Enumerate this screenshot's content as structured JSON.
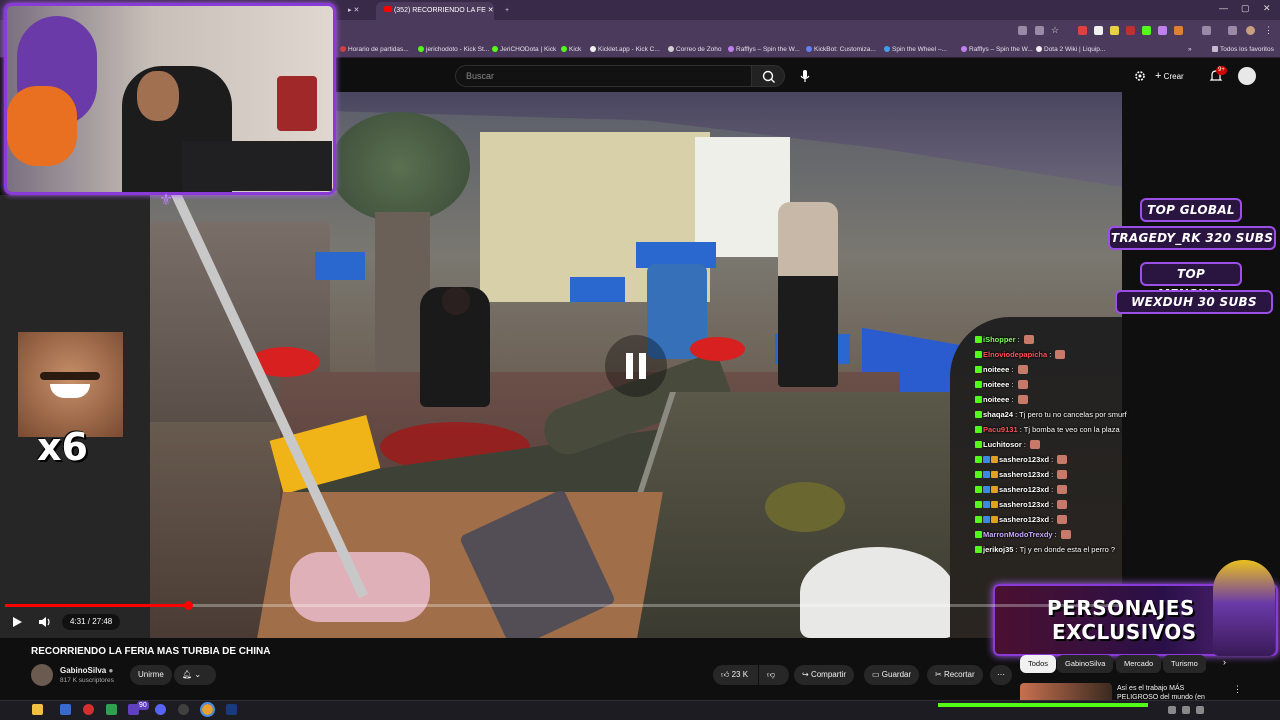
{
  "browser": {
    "tabs": [
      {
        "label": "(352) RECORRIENDO LA FE"
      }
    ],
    "bookmarks": [
      {
        "label": "Horario de partidas..."
      },
      {
        "label": "jerichodoto - Kick St..."
      },
      {
        "label": "JeriCHODota | Kick"
      },
      {
        "label": "Kick"
      },
      {
        "label": "Kicklet.app - Kick C..."
      },
      {
        "label": "Correo de Zoho"
      },
      {
        "label": "Rafflys – Spin the W..."
      },
      {
        "label": "KickBot: Customiza..."
      },
      {
        "label": "Spin the Wheel –..."
      },
      {
        "label": "Rafflys – Spin the W..."
      },
      {
        "label": "Dota 2 Wiki | Liquip..."
      }
    ],
    "all_bookmarks_label": "Todos los favoritos"
  },
  "header": {
    "search_placeholder": "Buscar",
    "create_label": "Crear",
    "notification_count": "9+"
  },
  "overlay": {
    "leaderboard": [
      {
        "label": "TOP GLOBAL"
      },
      {
        "label": "TRAGEDY_RK 320 SUBS"
      },
      {
        "label": "TOP MENSUAL"
      },
      {
        "label": "WEXDUH 30 SUBS"
      }
    ],
    "multiplier": "x6",
    "promo_line1": "PERSONAJES",
    "promo_line2": "EXCLUSIVOS"
  },
  "chat": [
    {
      "user": "iShopper",
      "message": "",
      "user_color": "#7cff5a"
    },
    {
      "user": "Elnoviodepapicha",
      "message": "",
      "user_color": "#ff4f5a"
    },
    {
      "user": "noiteee",
      "message": "",
      "user_color": "#ffffff"
    },
    {
      "user": "noiteee",
      "message": "",
      "user_color": "#ffffff"
    },
    {
      "user": "noiteee",
      "message": "",
      "user_color": "#ffffff"
    },
    {
      "user": "shaqa24",
      "message": "Tj pero tu no cancelas por smurf",
      "user_color": "#ffffff"
    },
    {
      "user": "Pacu9131",
      "message": "Tj bomba te veo con la plaza",
      "user_color": "#ff4f5a"
    },
    {
      "user": "Luchitosor",
      "message": "",
      "user_color": "#ffffff"
    },
    {
      "user": "sashero123xd",
      "message": "",
      "user_color": "#ffffff"
    },
    {
      "user": "sashero123xd",
      "message": "",
      "user_color": "#ffffff"
    },
    {
      "user": "sashero123xd",
      "message": "",
      "user_color": "#ffffff"
    },
    {
      "user": "sashero123xd",
      "message": "",
      "user_color": "#ffffff"
    },
    {
      "user": "sashero123xd",
      "message": "",
      "user_color": "#ffffff"
    },
    {
      "user": "MarronModoTrexdy",
      "message": "",
      "user_color": "#c8a8ff"
    },
    {
      "user": "jerikoj35",
      "message": "Tj y en donde esta el perro ?",
      "user_color": "#ffffff"
    }
  ],
  "player": {
    "progress": 0.164,
    "time_display": "4:31 / 27:48"
  },
  "video": {
    "title": "RECORRIENDO LA FERIA MAS TURBIA DE CHINA",
    "channel": "GabinoSilva",
    "subscribers": "817 K suscriptores",
    "join_label": "Unirme",
    "like_count": "23 K",
    "share_label": "Compartir",
    "save_label": "Guardar",
    "clip_label": "Recortar"
  },
  "sidebar": {
    "chips": [
      {
        "label": "Todos"
      },
      {
        "label": "GabinoSilva"
      },
      {
        "label": "Mercado"
      },
      {
        "label": "Turismo"
      }
    ],
    "recommendation_title": "Así es el trabajo MÁS PELIGROSO del mundo (en"
  },
  "taskbar": {
    "badge": "90"
  },
  "colors": {
    "accent_purple": "#8a3ad6",
    "progress_red": "#ff0000",
    "kick_green": "#53fc18"
  },
  "icons": [
    "play-icon",
    "volume-icon",
    "search-icon",
    "mic-icon",
    "bell-icon",
    "like-icon",
    "dislike-icon",
    "share-icon",
    "save-icon",
    "scissors-icon",
    "more-icon",
    "pause-icon"
  ]
}
